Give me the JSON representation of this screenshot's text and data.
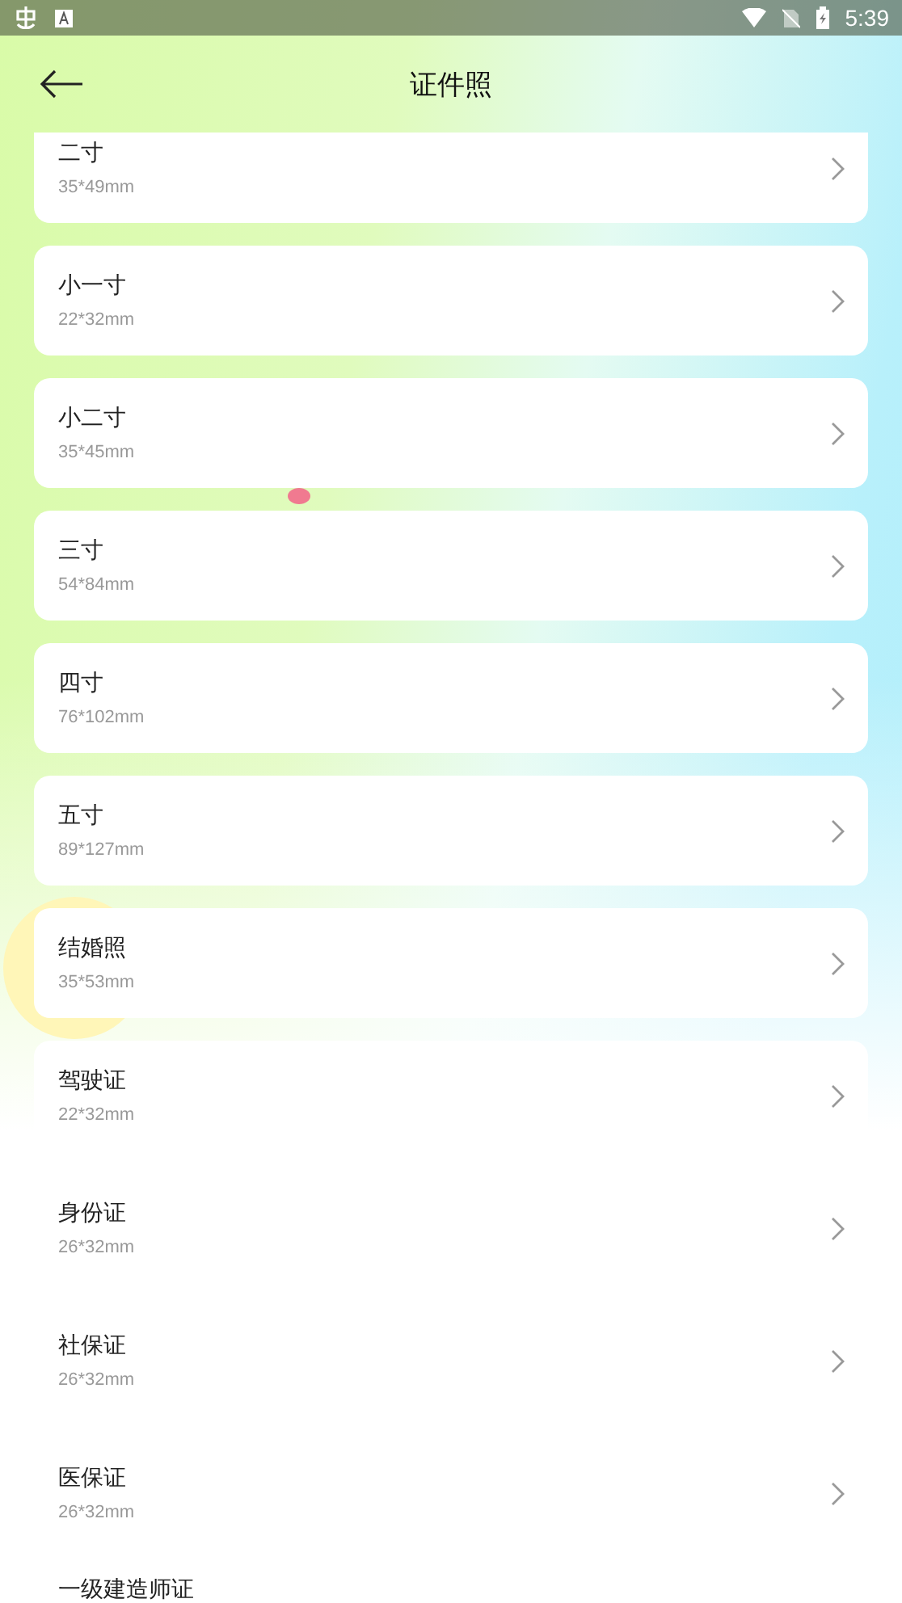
{
  "status_bar": {
    "time": "5:39"
  },
  "header": {
    "title": "证件照"
  },
  "items": [
    {
      "name": "二寸",
      "size": "35*49mm"
    },
    {
      "name": "小一寸",
      "size": "22*32mm"
    },
    {
      "name": "小二寸",
      "size": "35*45mm"
    },
    {
      "name": "三寸",
      "size": "54*84mm"
    },
    {
      "name": "四寸",
      "size": "76*102mm"
    },
    {
      "name": "五寸",
      "size": "89*127mm"
    },
    {
      "name": "结婚照",
      "size": "35*53mm"
    },
    {
      "name": "驾驶证",
      "size": "22*32mm"
    },
    {
      "name": "身份证",
      "size": "26*32mm"
    },
    {
      "name": "社保证",
      "size": "26*32mm"
    },
    {
      "name": "医保证",
      "size": "26*32mm"
    },
    {
      "name": "一级建造师证"
    }
  ]
}
